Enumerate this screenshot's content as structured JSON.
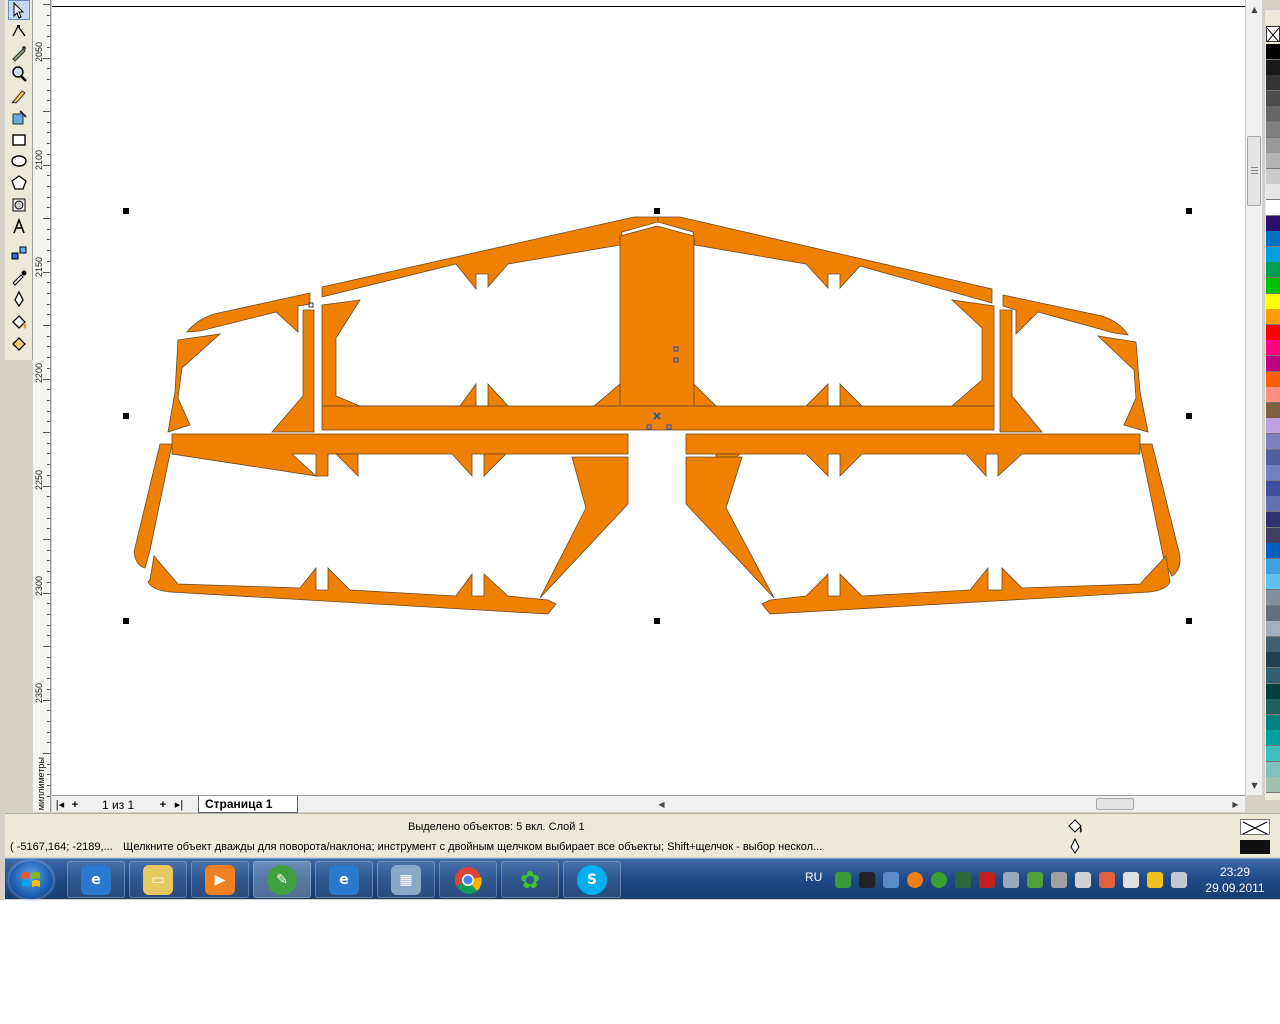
{
  "ruler": {
    "unit": "миллиметры",
    "labels": [
      "2050",
      "2100",
      "2150",
      "2200",
      "2250",
      "2300",
      "2350"
    ]
  },
  "page_nav": {
    "count": "1 из 1",
    "tab": "Страница 1"
  },
  "status": {
    "objects": "Выделено объектов: 5 вкл. Слой 1",
    "coords": "( -5167,164; -2189,...",
    "hint": "Щелкните объект дважды для поворота/наклона; инструмент с двойным щелчком выбирает все объекты; Shift+щелчок - выбор нескол..."
  },
  "taskbar": {
    "lang": "RU",
    "time": "23:29",
    "date": "29.09.2011"
  },
  "colors": {
    "shape_fill": "#f08000",
    "shape_outline": "#6a4a2a",
    "taskbar": "#1f4a86"
  },
  "palette": [
    "#000000",
    "#1a1a1a",
    "#333333",
    "#4d4d4d",
    "#666666",
    "#808080",
    "#999999",
    "#b3b3b3",
    "#cccccc",
    "#e6e6e6",
    "#ffffff",
    "#2b0f70",
    "#0070c0",
    "#00a0e0",
    "#00a050",
    "#00c000",
    "#ffff00",
    "#ffa000",
    "#ff0000",
    "#ff0080",
    "#c00080",
    "#ff6000",
    "#ff9080",
    "#806040",
    "#c0a0e0",
    "#8080c0",
    "#5060a0",
    "#7080c0",
    "#4050a0",
    "#6070b0",
    "#303070",
    "#404060",
    "#0060c0",
    "#40a0e0",
    "#60c0f0",
    "#8090a0",
    "#607080",
    "#a0b0c0",
    "#406070",
    "#204050",
    "#306070",
    "#004040",
    "#206060",
    "#008080",
    "#00a0a0",
    "#40c0c0",
    "#80c0c0",
    "#a0c0b0"
  ],
  "icons": {
    "toolbox": [
      "pick-tool-icon",
      "shape-tool-icon",
      "smear-tool-icon",
      "zoom-tool-icon",
      "freehand-tool-icon",
      "smart-fill-icon",
      "rectangle-tool-icon",
      "ellipse-tool-icon",
      "polygon-tool-icon",
      "basic-shapes-icon",
      "text-tool-icon",
      "blend-tool-icon",
      "eyedropper-icon",
      "outline-pen-icon",
      "fill-bucket-icon",
      "interactive-fill-icon"
    ]
  }
}
